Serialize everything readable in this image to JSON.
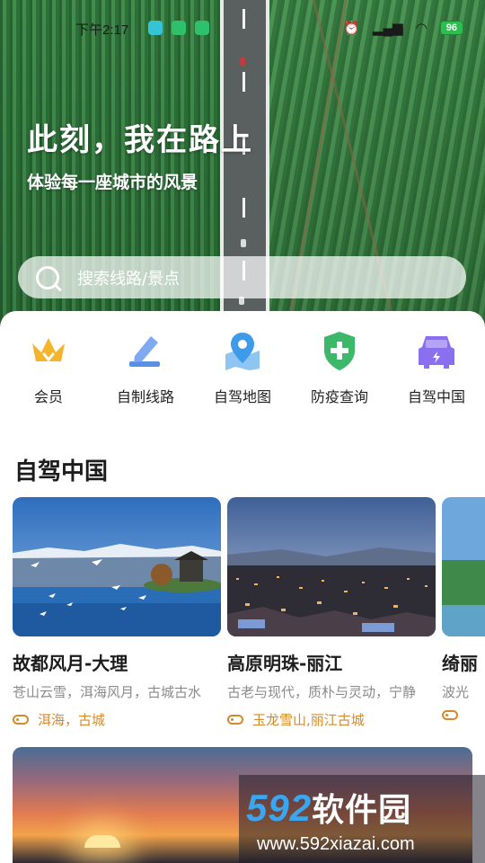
{
  "status_bar": {
    "time": "下午2:17",
    "battery": "96",
    "app_icon_colors": [
      "#35c4d6",
      "#2fc06c",
      "#2fc06c"
    ]
  },
  "hero": {
    "title": "此刻，我在路上",
    "subtitle": "体验每一座城市的风景",
    "search_placeholder": "搜索线路/景点"
  },
  "quick_menu": [
    {
      "label": "会员",
      "icon": "crown-icon",
      "color": "#f4b52c"
    },
    {
      "label": "自制线路",
      "icon": "pencil-icon",
      "color": "#5b8fe6"
    },
    {
      "label": "自驾地图",
      "icon": "map-pin-icon",
      "color": "#3d9be9"
    },
    {
      "label": "防疫查询",
      "icon": "shield-plus-icon",
      "color": "#3db86a"
    },
    {
      "label": "自驾中国",
      "icon": "car-icon",
      "color": "#8a6ff0"
    }
  ],
  "section": {
    "title": "自驾中国"
  },
  "cards": [
    {
      "title": "故都风月-大理",
      "desc": "苍山云雪，洱海风月，古城古水",
      "tags": "洱海，古城"
    },
    {
      "title": "高原明珠-丽江",
      "desc": "古老与现代，质朴与灵动，宁静",
      "tags": "玉龙雪山,丽江古城"
    },
    {
      "title": "绮丽",
      "desc": "波光",
      "tags": ""
    }
  ],
  "watermark": {
    "logo_num": "592",
    "logo_text": "软件园",
    "url": "www.592xiazai.com"
  },
  "colors": {
    "accent_tag": "#d48a2c"
  }
}
